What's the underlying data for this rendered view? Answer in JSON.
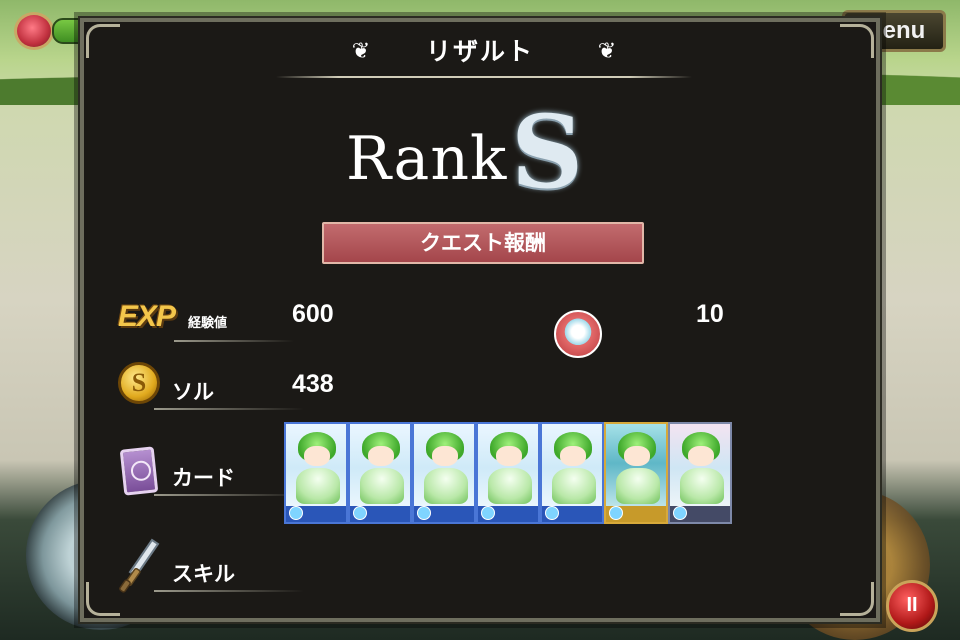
{
  "hud": {
    "menu_label": "Menu",
    "pause_label": "II"
  },
  "result": {
    "title": "リザルト",
    "rank_word": "Rank",
    "rank_letter": "S",
    "reward_header": "クエスト報酬",
    "exp": {
      "badge": "EXP",
      "label": "経験値",
      "value": "600"
    },
    "friend_points": {
      "icon": "handshake-icon",
      "value": "10"
    },
    "sol": {
      "label": "ソル",
      "value": "438"
    },
    "card": {
      "label": "カード",
      "count_shown": 7
    },
    "skill": {
      "label": "スキル"
    }
  },
  "colors": {
    "panel_bg": "#1b1916",
    "reward_bar": "#b35a5e",
    "exp_gold": "#f3c64b",
    "card_border_blue": "#4a76d6",
    "card_border_gold": "#d7a93a"
  }
}
